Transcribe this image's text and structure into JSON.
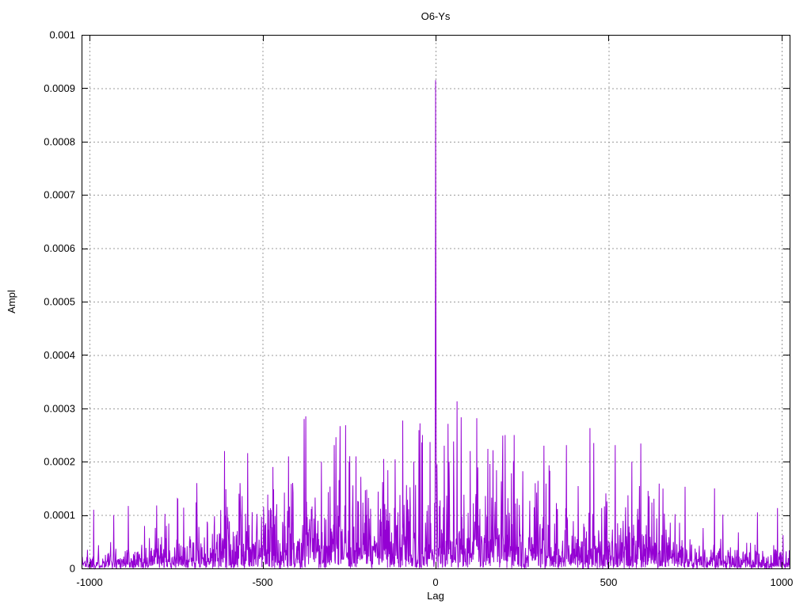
{
  "chart_data": {
    "type": "line",
    "title": "O6-Ys",
    "xlabel": "Lag",
    "ylabel": "Ampl",
    "xlim": [
      -1023,
      1023
    ],
    "ylim": [
      0,
      0.001
    ],
    "grid": true,
    "legend": "none",
    "x_ticks": {
      "values": [
        -1000,
        -500,
        0,
        500,
        1000
      ],
      "labels": [
        "-1000",
        "-500",
        "0",
        "500",
        "1000"
      ]
    },
    "y_ticks": {
      "values": [
        0,
        0.0001,
        0.0002,
        0.0003,
        0.0004,
        0.0005,
        0.0006,
        0.0007,
        0.0008,
        0.0009,
        0.001
      ],
      "labels": [
        "0",
        "0.0001",
        "0.0002",
        "0.0003",
        "0.0004",
        "0.0005",
        "0.0006",
        "0.0007",
        "0.0008",
        "0.0009",
        "0.001"
      ]
    },
    "line_color": "#9400d3",
    "grid_color": "#9b9b9b",
    "border_color": "#000000",
    "n_points": 2047,
    "main_peak": {
      "lag": 0,
      "value": 0.000915
    },
    "near_peak_values": [
      [
        -1,
        0.0003
      ],
      [
        1,
        0.0005
      ]
    ],
    "notable_peaks": [
      [
        -988,
        0.00011
      ],
      [
        -930,
        0.0001
      ],
      [
        -888,
        0.000117
      ],
      [
        -806,
        0.000118
      ],
      [
        -745,
        0.00013
      ],
      [
        -728,
        0.000114
      ],
      [
        -690,
        0.00016
      ],
      [
        -610,
        0.00022
      ],
      [
        -565,
        0.00016
      ],
      [
        -470,
        0.00019
      ],
      [
        -425,
        0.00021
      ],
      [
        -380,
        0.00028
      ],
      [
        -375,
        0.000285
      ],
      [
        -330,
        0.0002
      ],
      [
        -288,
        0.000246
      ],
      [
        -250,
        0.0002
      ],
      [
        -230,
        0.00021
      ],
      [
        -150,
        0.000205
      ],
      [
        -95,
        0.000277
      ],
      [
        -63,
        0.0002
      ],
      [
        -45,
        0.000272
      ],
      [
        -38,
        0.00025
      ],
      [
        25,
        0.00023
      ],
      [
        62,
        0.000313
      ],
      [
        100,
        0.00022
      ],
      [
        151,
        0.000224
      ],
      [
        201,
        0.00025
      ],
      [
        227,
        0.00025
      ],
      [
        313,
        0.00023
      ],
      [
        378,
        0.000231
      ],
      [
        446,
        0.000263
      ],
      [
        519,
        0.000231
      ],
      [
        567,
        0.0002
      ],
      [
        593,
        0.000234
      ],
      [
        721,
        0.000153
      ],
      [
        806,
        0.00015
      ],
      [
        930,
        0.000105
      ],
      [
        988,
        0.000113
      ]
    ],
    "noise_envelope": {
      "lags": [
        0,
        150,
        300,
        450,
        600,
        700,
        800,
        900,
        1023
      ],
      "means": [
        5.2e-05,
        5.1e-05,
        4.8e-05,
        4.3e-05,
        3.7e-05,
        2.7e-05,
        2e-05,
        1.5e-05,
        1.3e-05
      ],
      "max_factor": 5.5
    },
    "noise_seed": 1337
  }
}
